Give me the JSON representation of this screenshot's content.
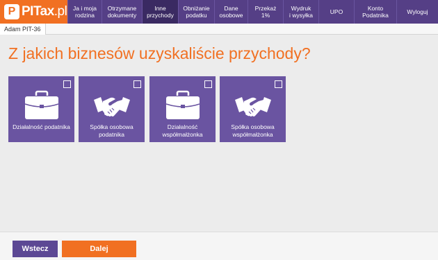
{
  "logo": {
    "mark": "P",
    "name": "PITax",
    "suffix": ".pl"
  },
  "nav": [
    {
      "label": "Ja i moja\nrodzina",
      "active": false
    },
    {
      "label": "Otrzymane\ndokumenty",
      "active": false
    },
    {
      "label": "Inne\nprzychody",
      "active": true
    },
    {
      "label": "Obniżanie\npodatku",
      "active": false
    },
    {
      "label": "Dane\nosobowe",
      "active": false
    },
    {
      "label": "Przekaż\n1%",
      "active": false
    },
    {
      "label": "Wydruk\ni wysyłka",
      "active": false
    },
    {
      "label": "UPO",
      "active": false
    },
    {
      "label": "Konto\nPodatnika",
      "active": false
    },
    {
      "label": "Wyloguj",
      "active": false
    }
  ],
  "subbar": {
    "user_label": "Adam PIT-36"
  },
  "main": {
    "title": "Z jakich biznesów uzyskaliście przychody?",
    "tiles": [
      {
        "label": "Działalność podatnika",
        "icon": "briefcase-icon",
        "checked": false
      },
      {
        "label": "Spółka osobowa podatnika",
        "icon": "handshake-icon",
        "checked": false
      },
      {
        "label": "Działalność współmałżonka",
        "icon": "briefcase-icon",
        "checked": false
      },
      {
        "label": "Spółka osobowa współmałżonka",
        "icon": "handshake-icon",
        "checked": false
      }
    ]
  },
  "footer": {
    "back_label": "Wstecz",
    "next_label": "Dalej"
  },
  "colors": {
    "brand_orange": "#f17022",
    "nav_purple": "#553f86",
    "tile_purple": "#6a54a1"
  }
}
